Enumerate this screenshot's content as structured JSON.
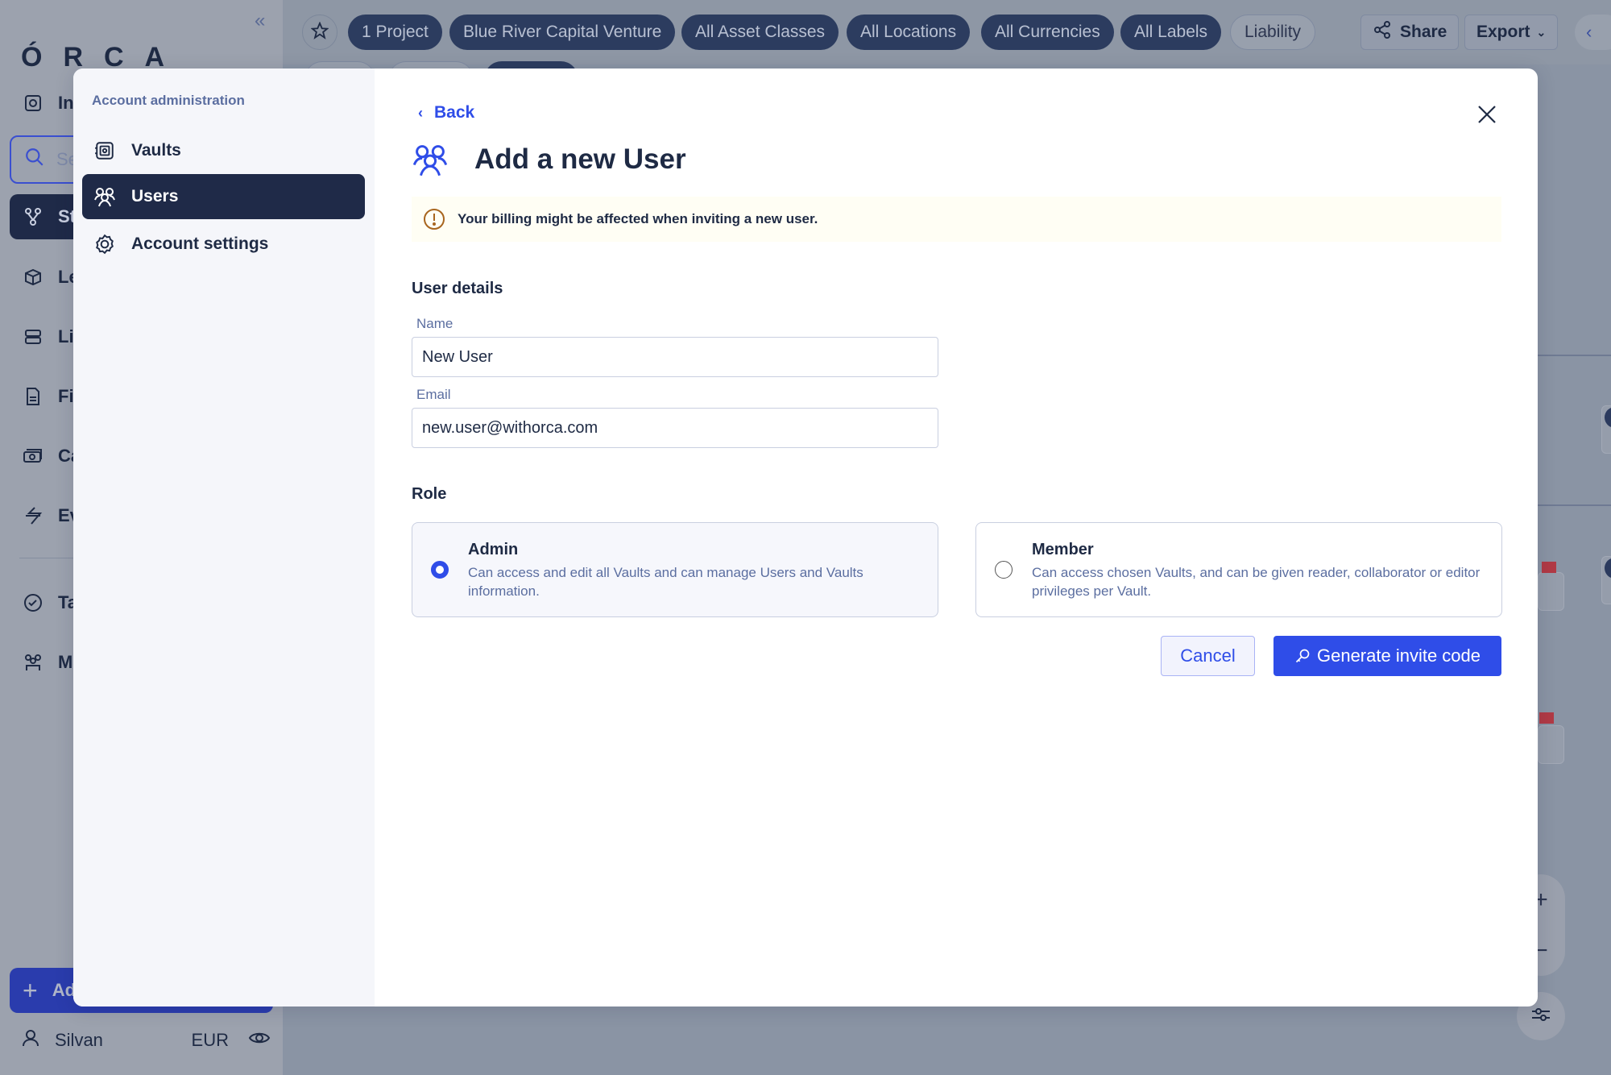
{
  "app": {
    "logo": "ÓRCA",
    "collapse_icon": "double-chevron-left-icon",
    "nav": [
      {
        "label": "Investments",
        "icon": "vault-icon"
      },
      {
        "label": "Structure",
        "icon": "structure-icon",
        "active": true
      },
      {
        "label": "Legal entities",
        "icon": "box-icon"
      },
      {
        "label": "Lists",
        "icon": "list-icon"
      },
      {
        "label": "Files",
        "icon": "file-icon"
      },
      {
        "label": "Cash",
        "icon": "cash-icon"
      },
      {
        "label": "Events",
        "icon": "events-icon"
      },
      {
        "label": "Tasks",
        "icon": "check-circle-icon"
      },
      {
        "label": "Members",
        "icon": "members-icon"
      }
    ],
    "search_placeholder": "Search",
    "add_label": "Add",
    "user": {
      "name": "Silvan",
      "currency": "EUR"
    }
  },
  "topbar": {
    "chips": [
      {
        "label": "1 Project",
        "style": "dark"
      },
      {
        "label": "Blue River Capital Venture",
        "style": "dark"
      },
      {
        "label": "All Asset Classes",
        "style": "dark"
      },
      {
        "label": "All Locations",
        "style": "dark"
      },
      {
        "label": "All Currencies",
        "style": "dark"
      },
      {
        "label": "All Labels",
        "style": "dark"
      },
      {
        "label": "Liability",
        "style": "light"
      }
    ],
    "share_label": "Share",
    "export_label": "Export"
  },
  "modal": {
    "sidebar": {
      "title": "Account administration",
      "items": [
        {
          "label": "Vaults",
          "icon": "vault-icon",
          "active": false
        },
        {
          "label": "Users",
          "icon": "users-icon",
          "active": true
        },
        {
          "label": "Account settings",
          "icon": "gear-icon",
          "active": false
        }
      ]
    },
    "back_label": "Back",
    "title": "Add a new User",
    "banner": "Your billing might be affected when inviting a new user.",
    "user_details": {
      "heading": "User details",
      "name_label": "Name",
      "name_value": "New User",
      "email_label": "Email",
      "email_value": "new.user@withorca.com"
    },
    "role": {
      "heading": "Role",
      "options": [
        {
          "name": "Admin",
          "description": "Can access and edit all Vaults and can manage Users and Vaults information.",
          "selected": true
        },
        {
          "name": "Member",
          "description": "Can access chosen Vaults, and can be given reader, collaborator or editor privileges per Vault.",
          "selected": false
        }
      ]
    },
    "cancel_label": "Cancel",
    "submit_label": "Generate invite code"
  },
  "colors": {
    "accent": "#2f4de8",
    "navy": "#1f2a48",
    "warning": "#a8651e",
    "banner_bg": "#fffef4"
  }
}
